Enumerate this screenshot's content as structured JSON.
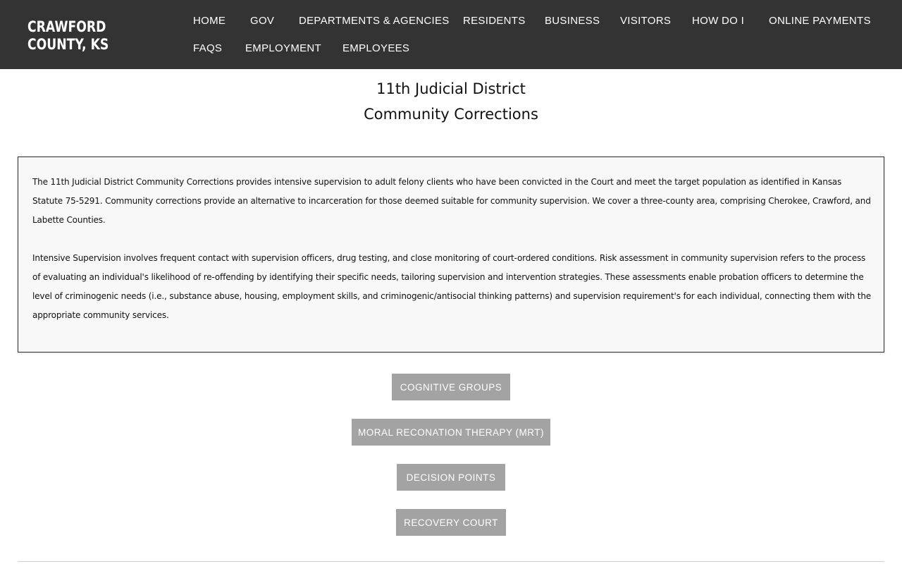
{
  "header": {
    "logo": "CRAWFORD COUNTY, KS",
    "nav": [
      "HOME",
      "GOV",
      "DEPARTMENTS & AGENCIES",
      "RESIDENTS",
      "BUSINESS",
      "VISITORS",
      "HOW DO I",
      "ONLINE PAYMENTS",
      "FAQS",
      "EMPLOYMENT",
      "EMPLOYEES"
    ]
  },
  "page": {
    "title_line1": "11th Judicial District",
    "title_line2": "Community Corrections"
  },
  "content": {
    "para1": "The 11th Judicial District Community Corrections provides intensive supervision to adult felony clients who have been convicted in the Court and meet the target population as identified in Kansas Statute 75-5291. Community corrections provide an alternative to incarceration for those deemed suitable for community supervision.    We cover a three-county area, comprising Cherokee, Crawford, and Labette Counties.",
    "para2": "Intensive Supervision involves frequent contact with supervision officers, drug testing, and close monitoring of court-ordered conditions.   Risk assessment in community supervision refers to the process of evaluating an individual's likelihood of re-offending by identifying their specific needs, tailoring supervision and intervention strategies. These assessments enable probation officers to determine the level of criminogenic needs (i.e., substance abuse, housing, employment skills, and criminogenic/antisocial thinking patterns) and supervision requirement's for each individual, connecting them with the appropriate community services."
  },
  "buttons": [
    "COGNITIVE GROUPS",
    "MORAL RECONATION THERAPY (MRT)",
    "DECISION POINTS",
    "RECOVERY COURT"
  ],
  "colors": {
    "header_bg": "#333333",
    "button_bg": "#a3a3a3",
    "content_bg": "#f8f8f8"
  }
}
